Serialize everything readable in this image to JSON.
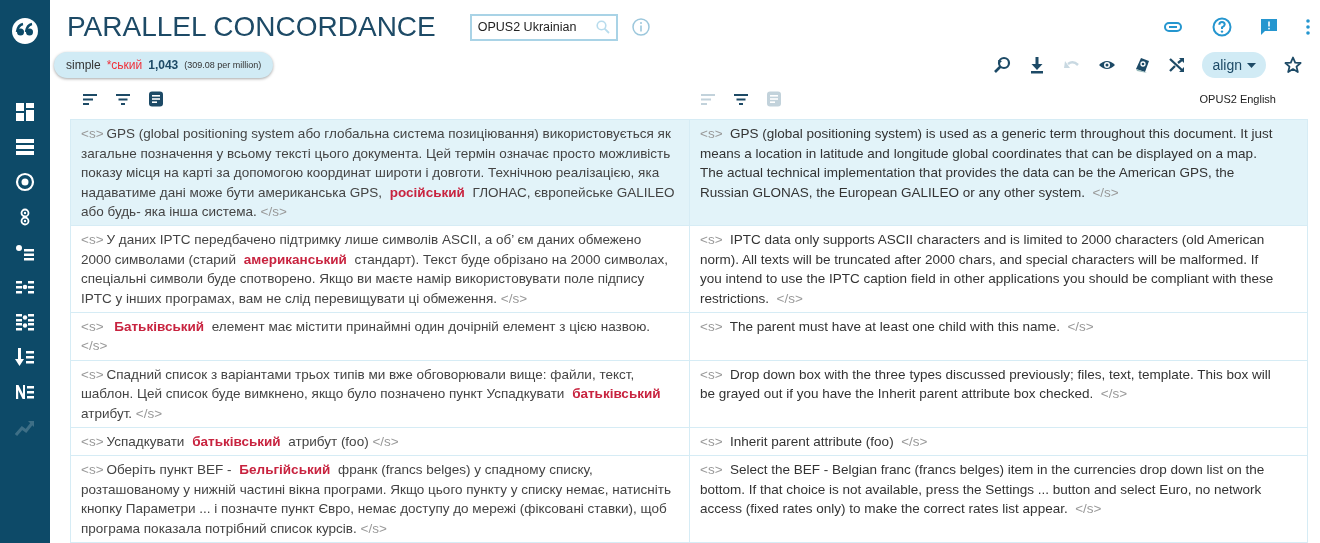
{
  "header": {
    "title": "PARALLEL CONCORDANCE",
    "corpus_field": {
      "value": "OPUS2 Ukrainian"
    }
  },
  "sidebar": {
    "items": [
      {
        "disabled": false
      },
      {
        "disabled": false
      },
      {
        "disabled": false
      },
      {
        "disabled": false
      },
      {
        "disabled": false
      },
      {
        "disabled": false
      },
      {
        "disabled": false
      },
      {
        "disabled": false
      },
      {
        "disabled": false
      },
      {
        "disabled": true
      }
    ]
  },
  "query": {
    "type": "simple",
    "term": "*ський",
    "count": "1,043",
    "frequency": "(309.08 per million)"
  },
  "toolbar": {
    "items": [
      {
        "disabled": false
      },
      {
        "disabled": false
      },
      {
        "disabled": true
      },
      {
        "disabled": false
      },
      {
        "disabled": false
      },
      {
        "disabled": false
      }
    ],
    "align_button": "align"
  },
  "columns": [
    {
      "disabled": false
    },
    {
      "disabled": true,
      "label": "OPUS2 English"
    }
  ],
  "rows": [
    {
      "selected": true,
      "left": {
        "open": "<s>",
        "before": "GPS (global positioning system або глобальна система позиціювання) використовується як загальне позначення у всьому тексті цього документа. Цей термін означає просто можливість показу місця на карті за допомогою координат широти і довготи. Технічною реалізацією, яка надаватиме дані може бути американська GPS, ",
        "hit": "російський",
        "after": " ГЛОНАС, європейське GALILEO або будь- яка інша система.",
        "close": "</s>"
      },
      "right": {
        "open": "<s>",
        "text": "GPS (global positioning system) is used as a generic term throughout this document. It just means a location in latitude and longitude global coordinates that can be displayed on a map. The actual technical implementation that provides the data can be the American GPS, the Russian GLONAS, the European GALILEO or any other system.",
        "close": "</s>"
      }
    },
    {
      "selected": false,
      "left": {
        "open": "<s>",
        "before": "У даних IPTC передбачено підтримку лише символів ASCII, а об’ єм даних обмежено 2000 символами (старий ",
        "hit": "американський",
        "after": " стандарт). Текст буде обрізано на 2000 символах, спеціальні символи буде спотворено. Якщо ви маєте намір використовувати поле підпису IPTC у інших програмах, вам не слід перевищувати ці обмеження.",
        "close": "</s>"
      },
      "right": {
        "open": "<s>",
        "text": "IPTC data only supports ASCII characters and is limited to 2000 characters (old American norm). All texts will be truncated after 2000 chars, and special characters will be malformed. If you intend to use the IPTC caption field in other applications you should be compliant with these restrictions.",
        "close": "</s>"
      }
    },
    {
      "selected": false,
      "left": {
        "open": "<s>",
        "hit": "Батьківський",
        "after": " елемент має містити принаймні один дочірній елемент з цією назвою.",
        "close": "</s>"
      },
      "right": {
        "open": "<s>",
        "text": "The parent must have at least one child with this name.",
        "close": "</s>"
      }
    },
    {
      "selected": false,
      "left": {
        "open": "<s>",
        "before": "Спадний список з варіантами трьох типів ми вже обговорювали вище: файли, текст, шаблон. Цей список буде вимкнено, якщо було позначено пункт Успадкувати ",
        "hit": "батьківський",
        "after": " атрибут.",
        "close": "</s>"
      },
      "right": {
        "open": "<s>",
        "text": "Drop down box with the three types discussed previously; files, text, template. This box will be grayed out if you have the Inherit parent attribute box checked.",
        "close": "</s>"
      }
    },
    {
      "selected": false,
      "left": {
        "open": "<s>",
        "before": "Успадкувати ",
        "hit": "батьківський",
        "after": " атрибут (foo)",
        "close": "</s>"
      },
      "right": {
        "open": "<s>",
        "text": "Inherit parent attribute (foo)",
        "close": "</s>"
      }
    },
    {
      "selected": false,
      "left": {
        "open": "<s>",
        "before": "Оберіть пункт BEF - ",
        "hit": "Бельгійський",
        "after": " франк (francs belges) у спадному списку, розташованому у нижній частині вікна програми. Якщо цього пункту у списку немає, натисніть кнопку Параметри ... і позначте пункт Євро, немає доступу до мережі (фіксовані ставки), щоб програма показала потрібний список курсів.",
        "close": "</s>"
      },
      "right": {
        "open": "<s>",
        "text": "Select the BEF - Belgian franc (francs belges) item in the currencies drop down list on the bottom. If that choice is not available, press the Settings ... button and select Euro, no network access (fixed rates only) to make the correct rates list appear.",
        "close": "</s>"
      }
    }
  ]
}
